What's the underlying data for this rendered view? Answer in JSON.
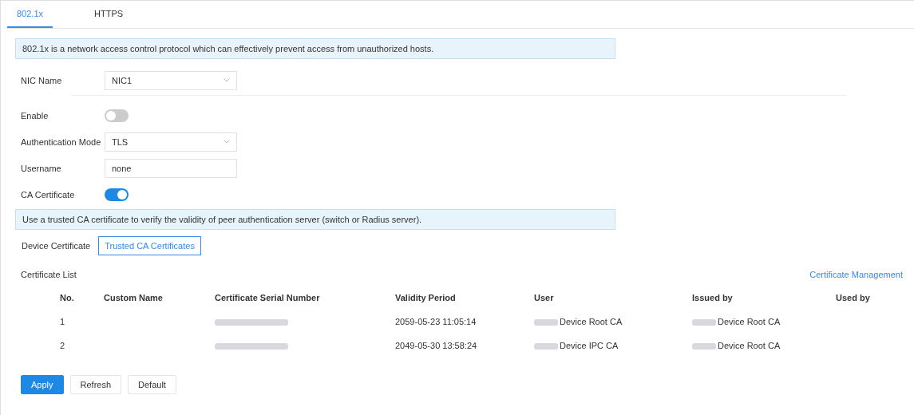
{
  "tabs": [
    {
      "label": "802.1x",
      "selected": true
    },
    {
      "label": "HTTPS",
      "selected": false
    }
  ],
  "notice": "802.1x is a network access control protocol which can effectively prevent access from unauthorized hosts.",
  "form": [
    {
      "kind": "select",
      "label": "NIC Name",
      "value": "NIC1",
      "divider": true
    },
    {
      "kind": "switch",
      "label": "Enable",
      "on": false
    },
    {
      "kind": "select",
      "label": "Authentication Mode",
      "value": "TLS"
    },
    {
      "kind": "input",
      "label": "Username",
      "value": "none"
    },
    {
      "kind": "switch",
      "label": "CA Certificate",
      "on": true
    }
  ],
  "ca_notice": "Use a trusted CA certificate to verify the validity of peer authentication server (switch or Radius server).",
  "cert_tabs": [
    {
      "label": "Device Certificate",
      "selected": false
    },
    {
      "label": "Trusted CA Certificates",
      "selected": true
    }
  ],
  "certificate_list": {
    "title": "Certificate List",
    "link": "Certificate Management",
    "columns": [
      "No.",
      "Custom Name",
      "Certificate Serial Number",
      "Validity Period",
      "User",
      "Issued by",
      "Used by"
    ],
    "rows": [
      {
        "no": "1",
        "custom_name": "",
        "serial_redacted": true,
        "validity": "2059-05-23 11:05:14",
        "user": "Device Root CA",
        "issued_by": "Device Root CA"
      },
      {
        "no": "2",
        "custom_name": "",
        "serial_redacted": true,
        "validity": "2049-05-30 13:58:24",
        "user": "Device IPC CA",
        "issued_by": "Device Root CA"
      }
    ]
  },
  "buttons": [
    {
      "label": "Apply",
      "kind": "primary"
    },
    {
      "label": "Refresh",
      "kind": "default"
    },
    {
      "label": "Default",
      "kind": "default"
    }
  ]
}
